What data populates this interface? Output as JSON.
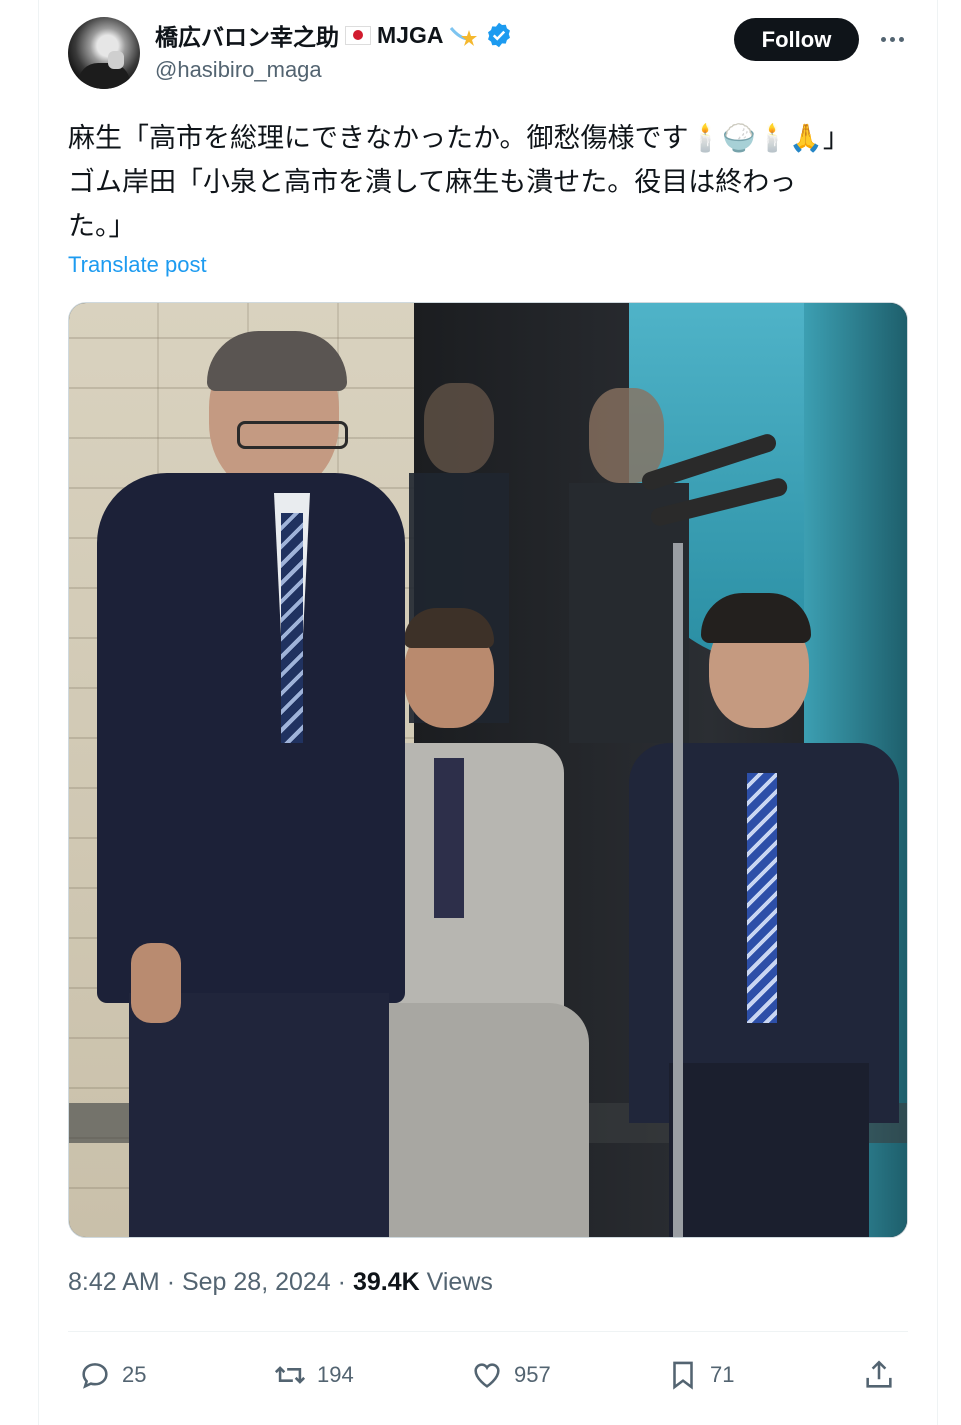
{
  "author": {
    "display_name": "橋広バロン幸之助",
    "badge_text": "MJGA",
    "handle": "@hasibiro_maga",
    "verified": true
  },
  "follow_label": "Follow",
  "tweet": {
    "lines": [
      "麻生「高市を総理にできなかったか。御愁傷様です🕯️🍚🕯️🙏」",
      "ゴム岸田「小泉と高市を潰して麻生も潰せた。役目は終わっ",
      "た。」"
    ],
    "translate_label": "Translate post"
  },
  "meta": {
    "time": "8:42 AM",
    "date": "Sep 28, 2024",
    "views_count": "39.4K",
    "views_label": "Views"
  },
  "actions": {
    "replies": "25",
    "reposts": "194",
    "likes": "957",
    "bookmarks": "71"
  },
  "colors": {
    "accent": "#1d9bf0",
    "follow_bg": "#0f1419",
    "muted": "#536471",
    "verified": "#1d9bf0"
  },
  "icons": [
    "more-icon",
    "verified-icon",
    "reply-icon",
    "repost-icon",
    "like-icon",
    "bookmark-icon",
    "share-icon"
  ]
}
